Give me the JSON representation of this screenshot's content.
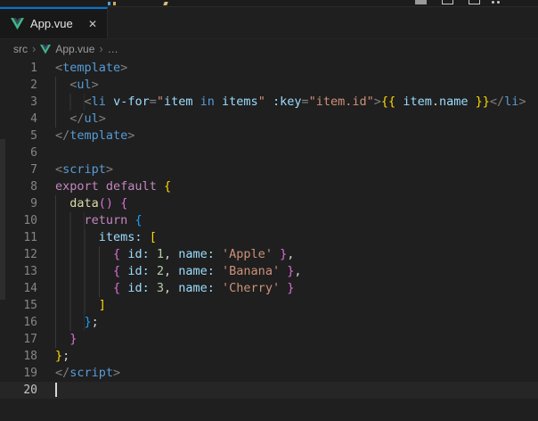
{
  "palette": {
    "accent_blue": "#0078d4",
    "vue_green": "#41b883",
    "vue_slate": "#35495e",
    "editor_bg": "#1f1f1f",
    "tab_bg": "#181818",
    "tag_color": "#569cd6",
    "attr_color": "#9cdcfe",
    "string_color": "#ce9178",
    "keyword_color": "#c586c0",
    "function_color": "#dcdcaa",
    "number_color": "#b5cea8",
    "bracket_gold": "#ffd700",
    "bracket_orchid": "#da70d6",
    "bracket_blue": "#179fff"
  },
  "tab": {
    "label": "App.vue",
    "close_glyph": "✕"
  },
  "breadcrumb": {
    "items": [
      "src",
      "App.vue",
      "…"
    ],
    "chevron_glyph": "›"
  },
  "editor": {
    "lines": [
      {
        "n": "1",
        "ind": 0,
        "toks": [
          [
            "ang",
            "<"
          ],
          [
            "tag",
            "template"
          ],
          [
            "ang",
            ">"
          ]
        ]
      },
      {
        "n": "2",
        "ind": 2,
        "toks": [
          [
            "ang",
            "<"
          ],
          [
            "tag",
            "ul"
          ],
          [
            "ang",
            ">"
          ]
        ]
      },
      {
        "n": "3",
        "ind": 4,
        "toks": [
          [
            "ang",
            "<"
          ],
          [
            "tag",
            "li"
          ],
          [
            "plain",
            " "
          ],
          [
            "attr",
            "v-for"
          ],
          [
            "ang",
            "="
          ],
          [
            "str",
            "\""
          ],
          [
            "var",
            "item"
          ],
          [
            "plain",
            " "
          ],
          [
            "kwb",
            "in"
          ],
          [
            "plain",
            " "
          ],
          [
            "var",
            "items"
          ],
          [
            "str",
            "\""
          ],
          [
            "plain",
            " "
          ],
          [
            "attr",
            ":key"
          ],
          [
            "ang",
            "="
          ],
          [
            "str",
            "\"item.id\""
          ],
          [
            "ang",
            ">"
          ],
          [
            "b1",
            "{{"
          ],
          [
            "plain",
            " "
          ],
          [
            "var",
            "item"
          ],
          [
            "pun",
            "."
          ],
          [
            "var",
            "name"
          ],
          [
            "plain",
            " "
          ],
          [
            "b1",
            "}}"
          ],
          [
            "ang",
            "</"
          ],
          [
            "tag",
            "li"
          ],
          [
            "ang",
            ">"
          ]
        ]
      },
      {
        "n": "4",
        "ind": 2,
        "toks": [
          [
            "ang",
            "</"
          ],
          [
            "tag",
            "ul"
          ],
          [
            "ang",
            ">"
          ]
        ]
      },
      {
        "n": "5",
        "ind": 0,
        "toks": [
          [
            "ang",
            "</"
          ],
          [
            "tag",
            "template"
          ],
          [
            "ang",
            ">"
          ]
        ]
      },
      {
        "n": "6",
        "ind": 0,
        "toks": []
      },
      {
        "n": "7",
        "ind": 0,
        "toks": [
          [
            "ang",
            "<"
          ],
          [
            "tag",
            "script"
          ],
          [
            "ang",
            ">"
          ]
        ]
      },
      {
        "n": "8",
        "ind": 0,
        "toks": [
          [
            "kw",
            "export"
          ],
          [
            "plain",
            " "
          ],
          [
            "kw",
            "default"
          ],
          [
            "plain",
            " "
          ],
          [
            "b1",
            "{"
          ]
        ]
      },
      {
        "n": "9",
        "ind": 2,
        "toks": [
          [
            "fn",
            "data"
          ],
          [
            "b2",
            "()"
          ],
          [
            "plain",
            " "
          ],
          [
            "b2",
            "{"
          ]
        ]
      },
      {
        "n": "10",
        "ind": 4,
        "toks": [
          [
            "kw",
            "return"
          ],
          [
            "plain",
            " "
          ],
          [
            "b3",
            "{"
          ]
        ]
      },
      {
        "n": "11",
        "ind": 6,
        "toks": [
          [
            "var",
            "items:"
          ],
          [
            "plain",
            " "
          ],
          [
            "b1",
            "["
          ]
        ]
      },
      {
        "n": "12",
        "ind": 8,
        "toks": [
          [
            "b2",
            "{"
          ],
          [
            "plain",
            " "
          ],
          [
            "var",
            "id:"
          ],
          [
            "plain",
            " "
          ],
          [
            "num",
            "1"
          ],
          [
            "pun",
            ","
          ],
          [
            "plain",
            " "
          ],
          [
            "var",
            "name:"
          ],
          [
            "plain",
            " "
          ],
          [
            "str",
            "'Apple'"
          ],
          [
            "plain",
            " "
          ],
          [
            "b2",
            "}"
          ],
          [
            "pun",
            ","
          ]
        ]
      },
      {
        "n": "13",
        "ind": 8,
        "toks": [
          [
            "b2",
            "{"
          ],
          [
            "plain",
            " "
          ],
          [
            "var",
            "id:"
          ],
          [
            "plain",
            " "
          ],
          [
            "num",
            "2"
          ],
          [
            "pun",
            ","
          ],
          [
            "plain",
            " "
          ],
          [
            "var",
            "name:"
          ],
          [
            "plain",
            " "
          ],
          [
            "str",
            "'Banana'"
          ],
          [
            "plain",
            " "
          ],
          [
            "b2",
            "}"
          ],
          [
            "pun",
            ","
          ]
        ]
      },
      {
        "n": "14",
        "ind": 8,
        "toks": [
          [
            "b2",
            "{"
          ],
          [
            "plain",
            " "
          ],
          [
            "var",
            "id:"
          ],
          [
            "plain",
            " "
          ],
          [
            "num",
            "3"
          ],
          [
            "pun",
            ","
          ],
          [
            "plain",
            " "
          ],
          [
            "var",
            "name:"
          ],
          [
            "plain",
            " "
          ],
          [
            "str",
            "'Cherry'"
          ],
          [
            "plain",
            " "
          ],
          [
            "b2",
            "}"
          ]
        ]
      },
      {
        "n": "15",
        "ind": 6,
        "toks": [
          [
            "b1",
            "]"
          ]
        ]
      },
      {
        "n": "16",
        "ind": 4,
        "toks": [
          [
            "b3",
            "}"
          ],
          [
            "pun",
            ";"
          ]
        ]
      },
      {
        "n": "17",
        "ind": 2,
        "toks": [
          [
            "b2",
            "}"
          ]
        ]
      },
      {
        "n": "18",
        "ind": 0,
        "toks": [
          [
            "b1",
            "}"
          ],
          [
            "pun",
            ";"
          ]
        ]
      },
      {
        "n": "19",
        "ind": 0,
        "toks": [
          [
            "ang",
            "</"
          ],
          [
            "tag",
            "script"
          ],
          [
            "ang",
            ">"
          ]
        ]
      },
      {
        "n": "20",
        "ind": 0,
        "toks": [],
        "active": true,
        "cursor": true
      }
    ]
  }
}
